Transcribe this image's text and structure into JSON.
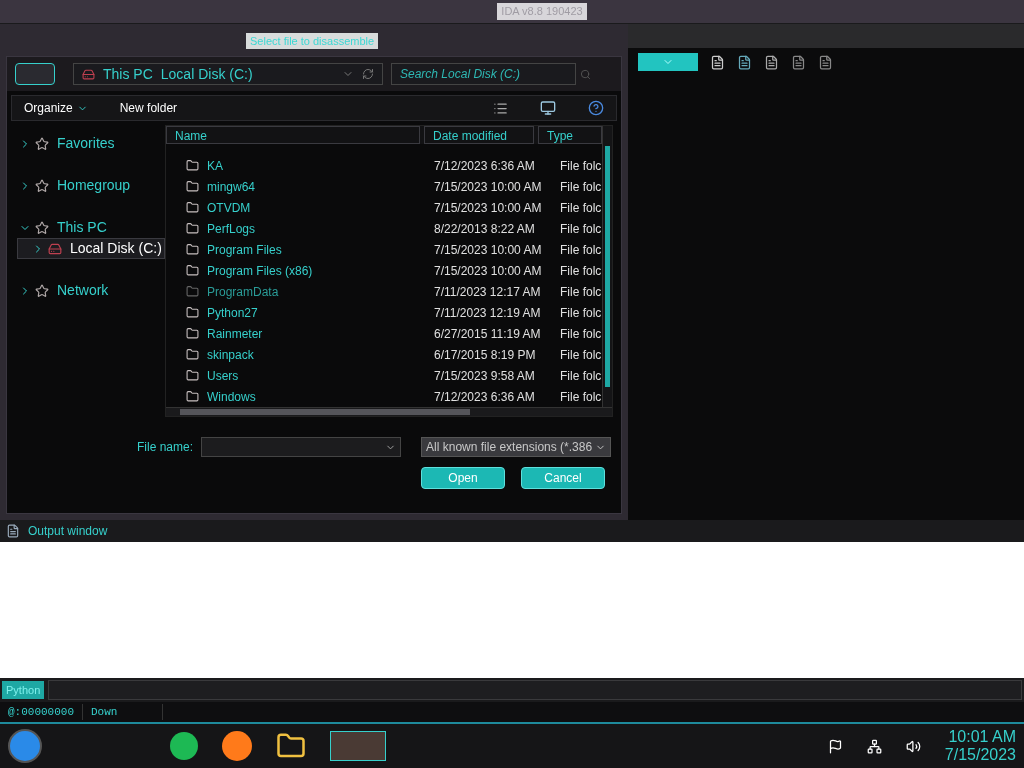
{
  "app_title": "IDA v8.8 190423",
  "dialog": {
    "title": "Select file to disassemble",
    "breadcrumb": [
      "This PC",
      "Local Disk (C:)"
    ],
    "search": {
      "placeholder": "Search Local Disk (C:)"
    },
    "toolbar": {
      "organize": "Organize",
      "new_folder": "New folder"
    },
    "nav": [
      {
        "label": "Favorites",
        "expanded": false,
        "selected": false
      },
      {
        "label": "Homegroup",
        "expanded": false,
        "selected": false
      },
      {
        "label": "This PC",
        "expanded": true,
        "selected": false,
        "children": [
          {
            "label": "Local Disk (C:)",
            "expanded": false,
            "selected": true
          }
        ]
      },
      {
        "label": "Network",
        "expanded": false,
        "selected": false
      }
    ],
    "columns": [
      "Name",
      "Date modified",
      "Type"
    ],
    "rows": [
      {
        "name": "KA",
        "date": "7/12/2023 6:36 AM",
        "type": "File folc",
        "hidden": false
      },
      {
        "name": "mingw64",
        "date": "7/15/2023 10:00 AM",
        "type": "File folc",
        "hidden": false
      },
      {
        "name": "OTVDM",
        "date": "7/15/2023 10:00 AM",
        "type": "File folc",
        "hidden": false
      },
      {
        "name": "PerfLogs",
        "date": "8/22/2013 8:22 AM",
        "type": "File folc",
        "hidden": false
      },
      {
        "name": "Program Files",
        "date": "7/15/2023 10:00 AM",
        "type": "File folc",
        "hidden": false
      },
      {
        "name": "Program Files (x86)",
        "date": "7/15/2023 10:00 AM",
        "type": "File folc",
        "hidden": false
      },
      {
        "name": "ProgramData",
        "date": "7/11/2023 12:17 AM",
        "type": "File folc",
        "hidden": true
      },
      {
        "name": "Python27",
        "date": "7/11/2023 12:19 AM",
        "type": "File folc",
        "hidden": false
      },
      {
        "name": "Rainmeter",
        "date": "6/27/2015 11:19 AM",
        "type": "File folc",
        "hidden": false
      },
      {
        "name": "skinpack",
        "date": "6/17/2015 8:19 PM",
        "type": "File folc",
        "hidden": false
      },
      {
        "name": "Users",
        "date": "7/15/2023 9:58 AM",
        "type": "File folc",
        "hidden": false
      },
      {
        "name": "Windows",
        "date": "7/12/2023 6:36 AM",
        "type": "File folc",
        "hidden": false
      }
    ],
    "file_name_label": "File name:",
    "file_type": "All known file extensions (*.386",
    "buttons": [
      "Open",
      "Cancel"
    ]
  },
  "output": {
    "title": "Output window"
  },
  "console": {
    "language": "Python"
  },
  "status": [
    "@:00000000",
    "Down"
  ],
  "clock": {
    "time": "10:01 AM",
    "date": "7/15/2023"
  }
}
